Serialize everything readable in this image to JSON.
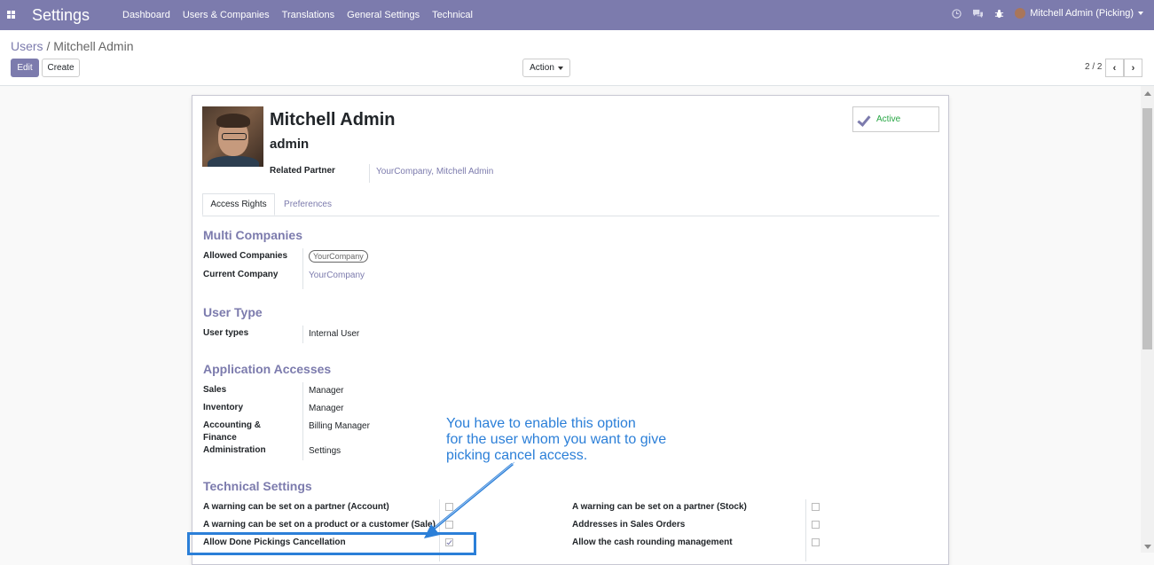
{
  "navbar": {
    "app_title": "Settings",
    "menu": [
      "Dashboard",
      "Users & Companies",
      "Translations",
      "General Settings",
      "Technical"
    ],
    "user": "Mitchell Admin (Picking)",
    "color": "#7c7bad"
  },
  "control_panel": {
    "breadcrumb_parent": "Users",
    "breadcrumb_separator": "/",
    "breadcrumb_current": "Mitchell Admin",
    "edit_label": "Edit",
    "create_label": "Create",
    "action_label": "Action",
    "pager": "2 / 2",
    "prev_icon": "‹",
    "next_icon": "›"
  },
  "form": {
    "name": "Mitchell Admin",
    "login": "admin",
    "related_partner_label": "Related Partner",
    "related_partner_value": "YourCompany, Mitchell Admin",
    "active_label": "Active",
    "tabs": [
      "Access Rights",
      "Preferences"
    ],
    "multi_companies": {
      "title": "Multi Companies",
      "allowed_label": "Allowed Companies",
      "allowed_tag": "YourCompany",
      "current_label": "Current Company",
      "current_value": "YourCompany"
    },
    "user_type": {
      "title": "User Type",
      "label": "User types",
      "value": "Internal User"
    },
    "app_accesses": {
      "title": "Application Accesses",
      "rows": [
        {
          "label": "Sales",
          "value": "Manager"
        },
        {
          "label": "Inventory",
          "value": "Manager"
        },
        {
          "label": "Accounting &",
          "value": "Billing Manager"
        },
        {
          "label": "Finance",
          "value": ""
        },
        {
          "label": "Administration",
          "value": "Settings"
        }
      ]
    },
    "technical": {
      "title": "Technical Settings",
      "left": [
        {
          "label": "A warning can be set on a partner (Account)",
          "checked": false
        },
        {
          "label": "A warning can be set on a product or a customer (Sale)",
          "checked": false
        },
        {
          "label": "Allow Done Pickings Cancellation",
          "checked": true
        }
      ],
      "right": [
        {
          "label": "A warning can be set on a partner (Stock)",
          "checked": false
        },
        {
          "label": "Addresses in Sales Orders",
          "checked": false
        },
        {
          "label": "Allow the cash rounding management",
          "checked": false
        }
      ]
    }
  },
  "annotation": {
    "line1": "You have to enable this option",
    "line2": "for the user whom you want to give",
    "line3": "picking cancel access.",
    "color": "#2b7fd8"
  }
}
